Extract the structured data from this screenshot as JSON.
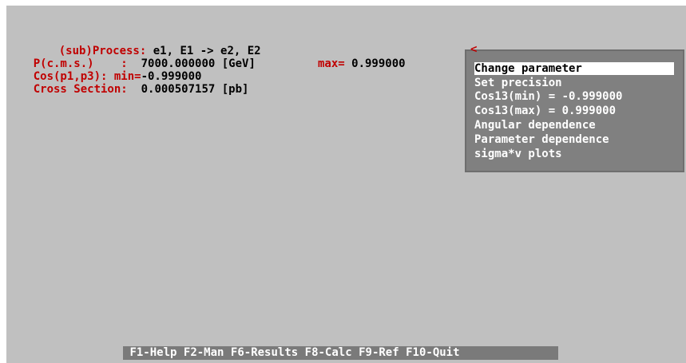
{
  "process": {
    "label": "(sub)Process:",
    "value": " e1, E1 -> e2, E2"
  },
  "pcms": {
    "label": "P(c.m.s.)    :",
    "value": "  7000.000000 [GeV]"
  },
  "cos": {
    "label": "Cos(p1,p3): min=",
    "min_value": "-0.999000",
    "max_label": "max=",
    "max_value": " 0.999000"
  },
  "cross_section": {
    "label": "Cross Section:",
    "value": "  0.000507157 [pb]"
  },
  "menu": {
    "corner": "<",
    "items": [
      "Change parameter",
      "Set precision",
      "Cos13(min) = -0.999000",
      "Cos13(max) = 0.999000",
      "Angular dependence",
      "Parameter dependence",
      "sigma*v plots"
    ]
  },
  "function_keys": [
    "F1-Help",
    "F2-Man",
    "F6-Results",
    "F8-Calc",
    "F9-Ref",
    "F10-Quit"
  ]
}
